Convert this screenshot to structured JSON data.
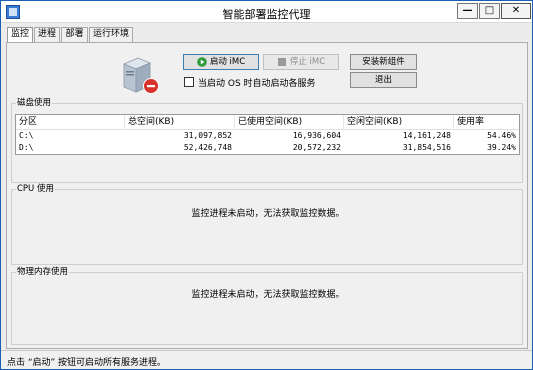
{
  "window": {
    "title": "智能部署监控代理",
    "minimize": "—",
    "maximize": "□",
    "close": "✕"
  },
  "tabs": [
    {
      "label": "监控",
      "active": true
    },
    {
      "label": "进程",
      "active": false
    },
    {
      "label": "部署",
      "active": false
    },
    {
      "label": "运行环境",
      "active": false
    }
  ],
  "controls": {
    "start_label": "启动 iMC",
    "stop_label": "停止 iMC",
    "install_label": "安装新组件",
    "exit_label": "退出",
    "autostart_label": "当启动 OS 时自动启动各服务",
    "autostart_checked": false
  },
  "disk": {
    "title": "磁盘使用",
    "columns": [
      "分区",
      "总空间(KB)",
      "已使用空间(KB)",
      "空闲空间(KB)",
      "使用率"
    ],
    "rows": [
      [
        "C:\\",
        "31,097,852",
        "16,936,604",
        "14,161,248",
        "54.46%"
      ],
      [
        "D:\\",
        "52,426,748",
        "20,572,232",
        "31,854,516",
        "39.24%"
      ]
    ]
  },
  "cpu": {
    "title": "CPU 使用",
    "message": "监控进程未启动，无法获取监控数据。"
  },
  "memory": {
    "title": "物理内存使用",
    "message": "监控进程未启动，无法获取监控数据。"
  },
  "status": {
    "text": "点击 “启动” 按钮可启动所有服务进程。"
  },
  "colors": {
    "accent": "#1a5fb4",
    "start_icon": "#2e9b3a",
    "server_badge": "#d9322b"
  },
  "icons": {
    "app": "app-icon",
    "server": "server-icon",
    "play": "play-icon",
    "stop": "stop-icon"
  }
}
